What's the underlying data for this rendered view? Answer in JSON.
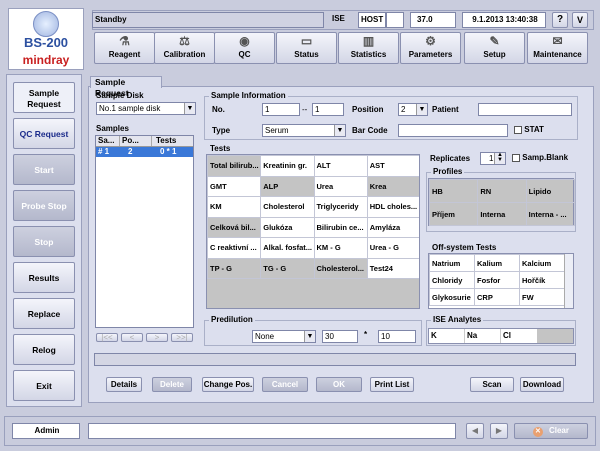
{
  "logo": {
    "model": "BS-200",
    "brand": "mindray"
  },
  "status": {
    "state": "Standby",
    "ise": "ISE",
    "host": "HOST",
    "temp": "37.0",
    "datetime": "9.1.2013 13:40:38",
    "help": "?",
    "collapse": "V"
  },
  "toolbar": [
    "Reagent",
    "Calibration",
    "QC",
    "Status",
    "Statistics",
    "Parameters",
    "Setup",
    "Maintenance"
  ],
  "sidebar": [
    "Sample Request",
    "QC Request",
    "Start",
    "Probe Stop",
    "Stop",
    "Results",
    "Replace",
    "Relog",
    "Exit"
  ],
  "tab": "Sample Request",
  "sample_disk": {
    "label": "Sample Disk",
    "value": "No.1 sample disk"
  },
  "samples": {
    "label": "Samples",
    "headers": [
      "Sa...",
      "Po...",
      "Tests"
    ],
    "row": [
      "# 1",
      "2",
      "0 * 1"
    ]
  },
  "sample_info": {
    "label": "Sample Information",
    "no_label": "No.",
    "no_from": "1",
    "no_sep": "--",
    "no_to": "1",
    "position_label": "Position",
    "position": "2",
    "patient_label": "Patient",
    "type_label": "Type",
    "type": "Serum",
    "barcode_label": "Bar Code",
    "stat_label": "STAT"
  },
  "tests": {
    "label": "Tests",
    "rows": [
      [
        "Total bilirub...",
        "Kreatinin gr.",
        "ALT",
        "AST"
      ],
      [
        "GMT",
        "ALP",
        "Urea",
        "Krea"
      ],
      [
        "KM",
        "Cholesterol",
        "Triglyceridy",
        "HDL choles..."
      ],
      [
        "Celková bil...",
        "Glukóza",
        "Bilirubin ce...",
        "Amyláza"
      ],
      [
        "C reaktivní ...",
        "Alkal. fosfat...",
        "KM - G",
        "Urea - G"
      ],
      [
        "TP - G",
        "TG - G",
        "Cholesterol...",
        "Test24"
      ]
    ]
  },
  "replicates": {
    "label": "Replicates",
    "value": "1",
    "blank_label": "Samp.Blank"
  },
  "profiles": {
    "label": "Profiles",
    "rows": [
      [
        "HB",
        "RN",
        "Lipido"
      ],
      [
        "Příjem",
        "Interna",
        "Interna - ..."
      ]
    ]
  },
  "offsystem": {
    "label": "Off-system Tests",
    "rows": [
      [
        "Natrium",
        "Kalium",
        "Kalcium"
      ],
      [
        "Chloridy",
        "Fosfor",
        "Hořčík"
      ],
      [
        "Glykosurie",
        "CRP",
        "FW"
      ]
    ]
  },
  "predilution": {
    "label": "Predilution",
    "mode": "None",
    "value1": "30",
    "times": "*",
    "value2": "10"
  },
  "ise": {
    "label": "ISE Analytes",
    "items": [
      "K",
      "Na",
      "Cl"
    ]
  },
  "buttons": [
    "Details",
    "Delete",
    "Change Pos.",
    "Cancel",
    "OK",
    "Print List",
    "Scan",
    "Download"
  ],
  "footer": {
    "user": "Admin",
    "clear": "Clear"
  }
}
